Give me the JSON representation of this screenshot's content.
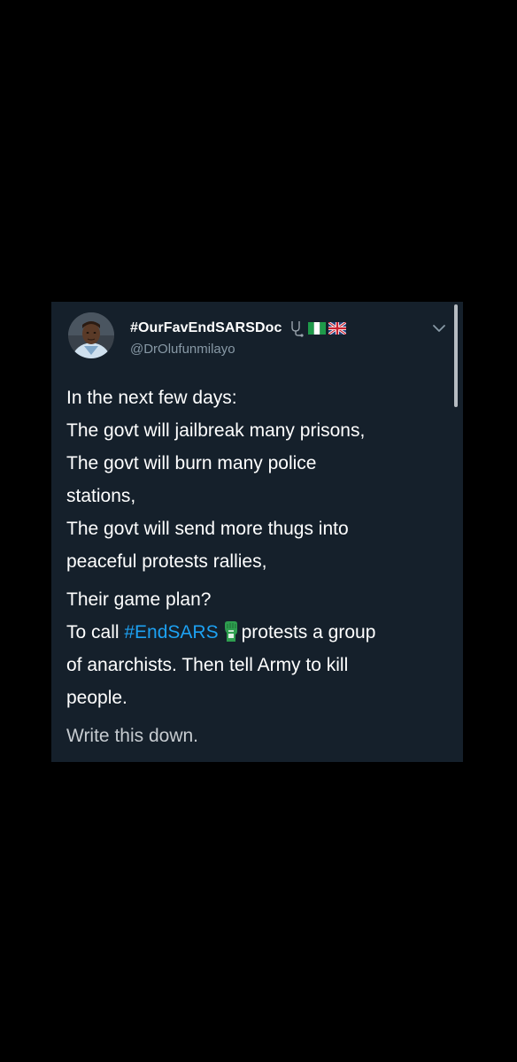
{
  "tweet": {
    "display_name": "#OurFavEndSARSDoc",
    "name_icons": [
      "stethoscope-icon",
      "nigeria-flag-icon",
      "uk-flag-icon"
    ],
    "handle": "@DrOlufunmilayo",
    "menu_icon": "chevron-down-icon",
    "body": {
      "para1": [
        "In the next few days:",
        "The govt will jailbreak many prisons,",
        "The govt will burn many police",
        "stations,",
        "The govt will send more thugs into",
        "peaceful protests rallies,"
      ],
      "para2": {
        "line1": "Their game plan?",
        "line2_prefix": "To call",
        "hashtag": "#EndSARS",
        "hashtag_icon": "raised-fist-icon",
        "line2_suffix": "protests a group",
        "line3": "of anarchists. Then tell Army to kill",
        "line4": "people."
      },
      "para3": "Write this down."
    }
  },
  "colors": {
    "background": "#000000",
    "card": "#15202b",
    "text": "#ffffff",
    "secondary_text": "#8899a6",
    "link": "#1da1f2",
    "fist_green": "#2e9e4f"
  }
}
